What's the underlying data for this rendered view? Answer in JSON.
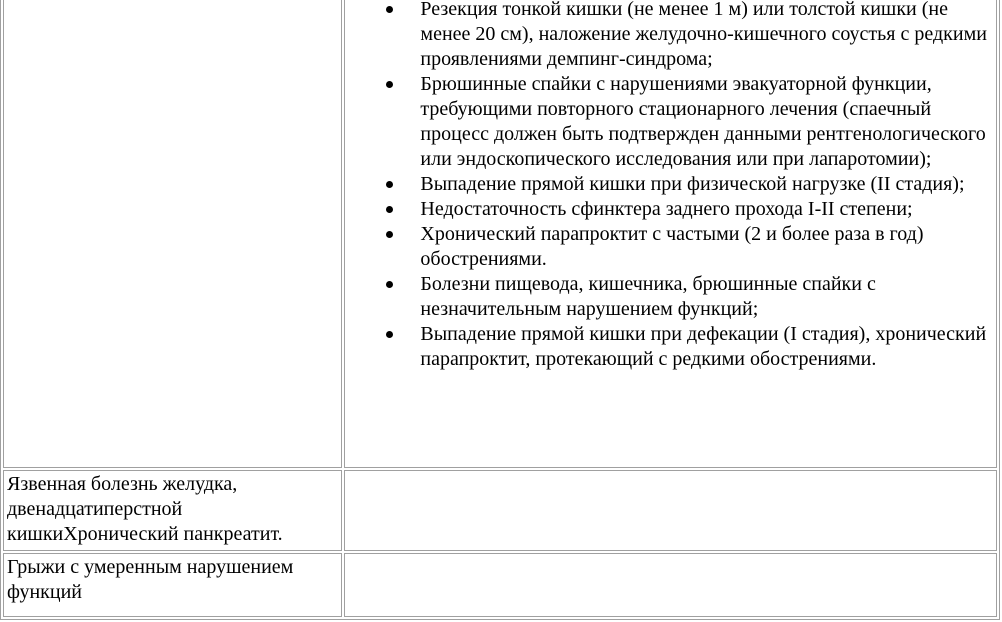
{
  "table": {
    "rows": [
      {
        "left_text": "",
        "items": [
          "Резекция тонкой кишки (не менее 1 м) или толстой кишки (не менее 20 см), наложение желудочно-кишечного соустья с редкими проявлениями демпинг-синдрома;",
          "Брюшинные спайки с нарушениями эвакуаторной функции, требующими повторного стационарного лечения (спаечный процесс должен быть подтвержден данными рентгенологического или эндоскопического исследования или при лапаротомии);",
          "Выпадение прямой кишки при физической нагрузке (II стадия);",
          "Недостаточность сфинктера заднего прохода I-II степени;",
          "Хронический парапроктит с частыми (2 и более раза в год) обострениями.",
          "Болезни пищевода, кишечника, брюшинные спайки с незначительным нарушением функций;",
          "Выпадение прямой кишки при дефекации (I стадия), хронический парапроктит, протекающий с редкими обострениями."
        ]
      },
      {
        "left_text": "Язвенная болезнь желудка, двенадцатиперстной кишкиХронический панкреатит.",
        "right_text": ""
      },
      {
        "left_text": "Грыжи с умеренным нарушением функций",
        "right_text": ""
      }
    ]
  }
}
